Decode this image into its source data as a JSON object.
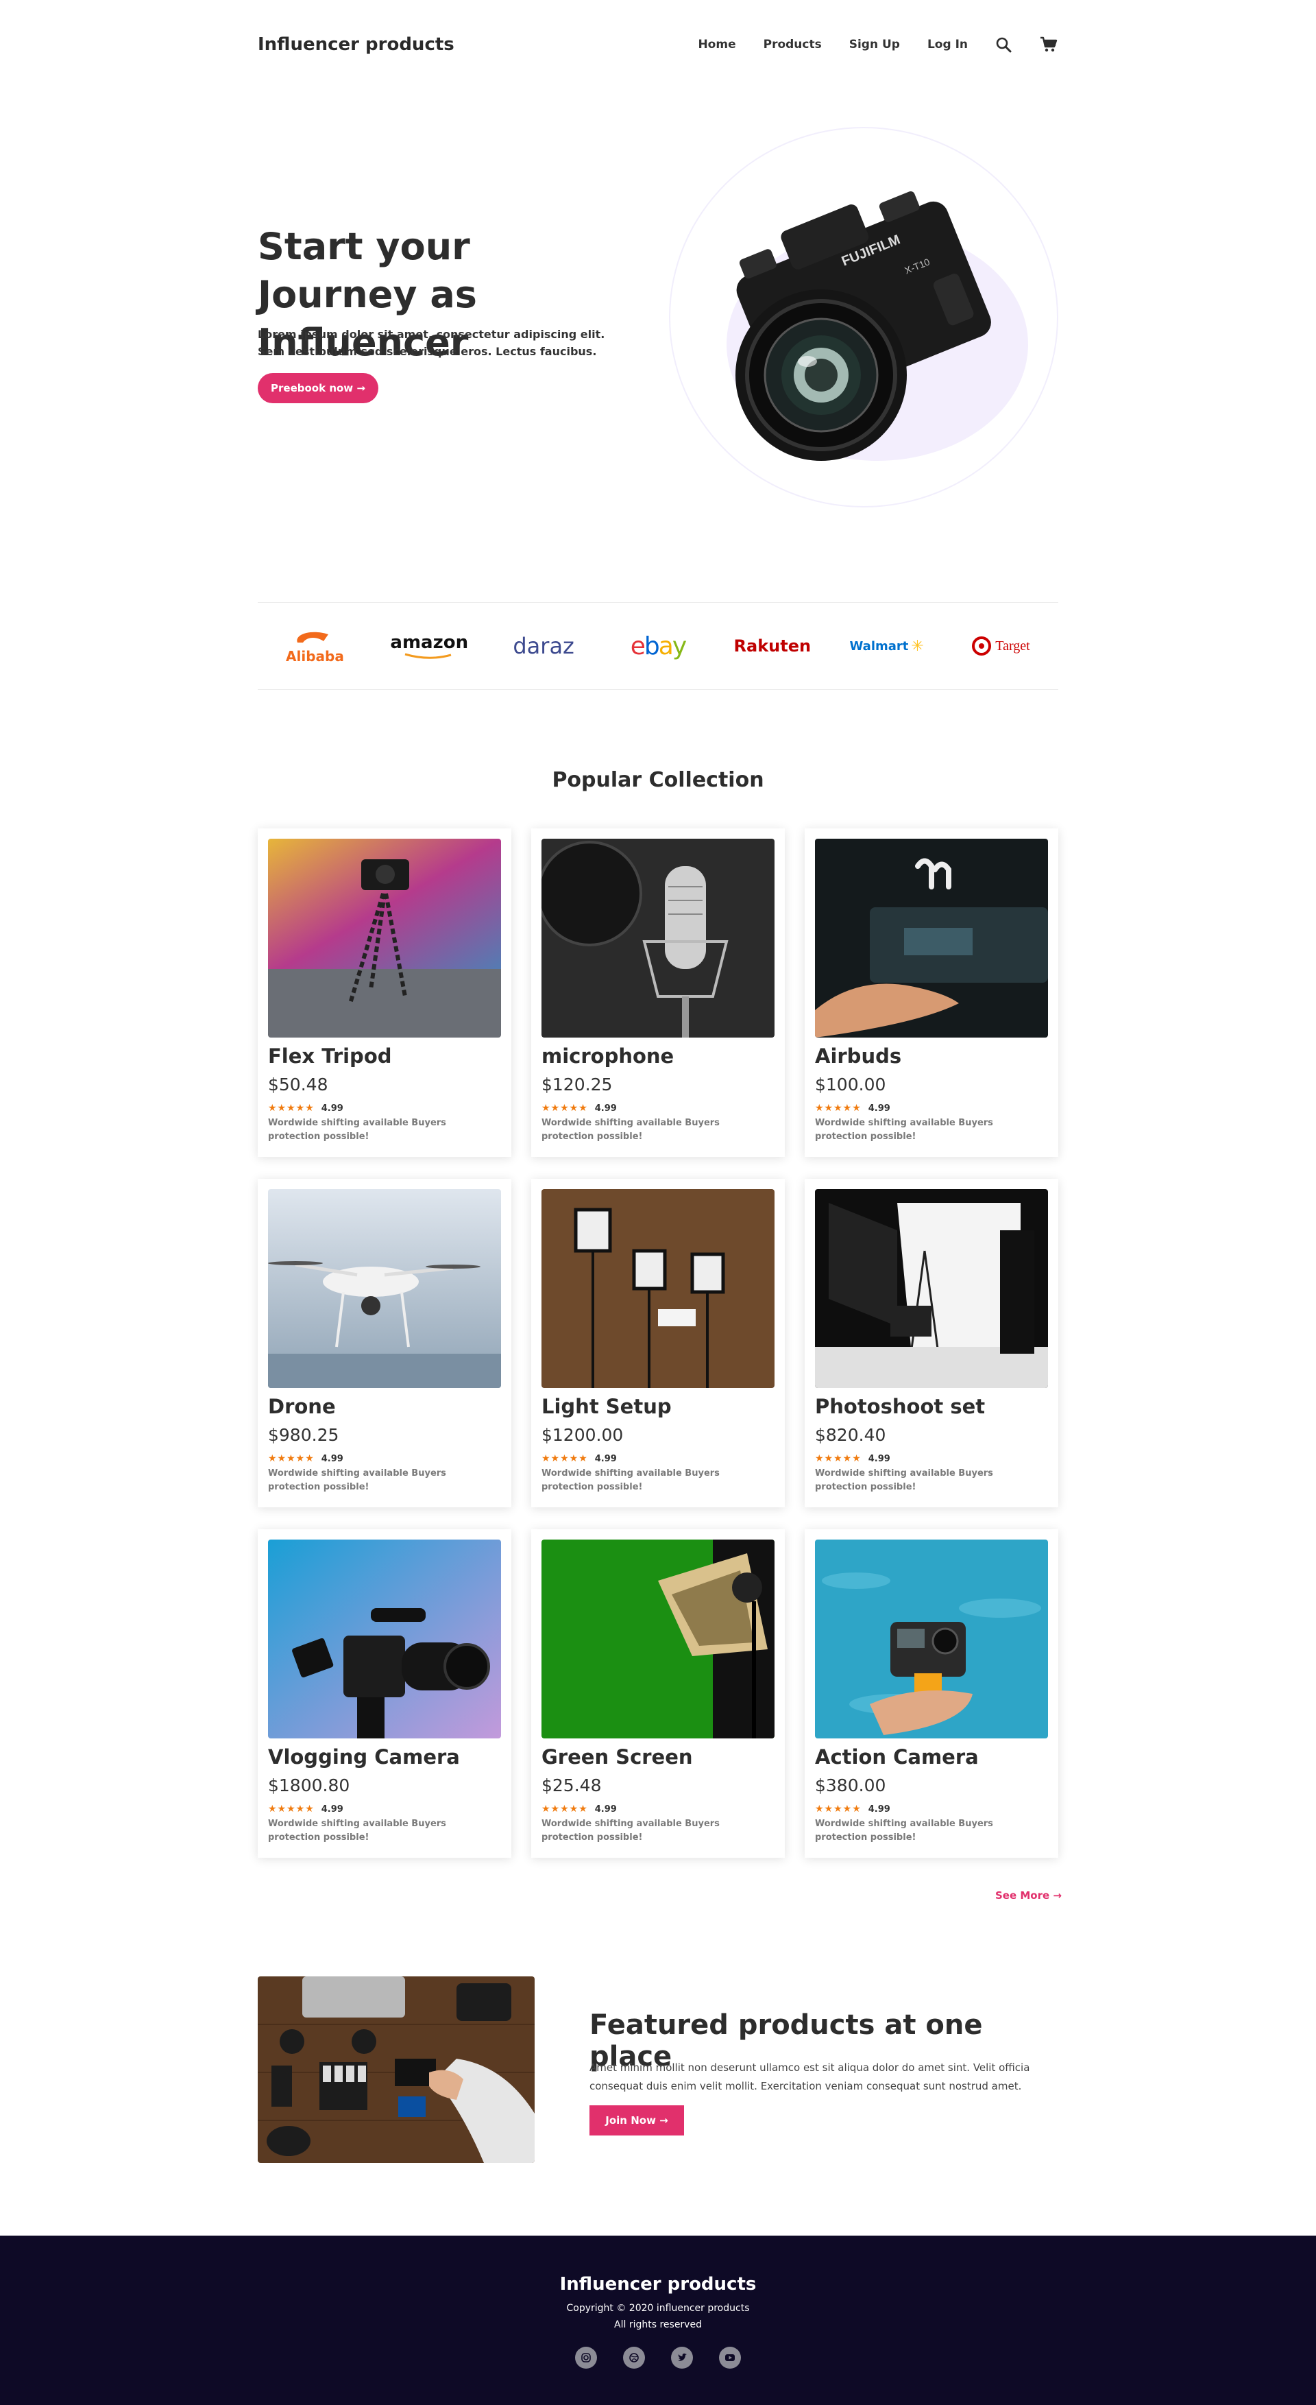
{
  "nav": {
    "brand": "Influencer products",
    "links": [
      "Home",
      "Products",
      "Sign Up",
      "Log In"
    ],
    "search_icon": "search-icon",
    "cart_icon": "cart-icon"
  },
  "hero": {
    "title": "Start your Journey as Influencer",
    "text": "Lorem ipsum dolor sit amet, consectetur adipiscing elit. Sem vestibulum sed scelerisque eros. Lectus faucibus.",
    "button": "Preebook now →",
    "camera_brand": "FUJIFILM",
    "camera_model": "X-T10"
  },
  "brands": [
    "Alibaba",
    "amazon",
    "daraz",
    "ebay",
    "Rakuten",
    "Walmart",
    "Target"
  ],
  "collection": {
    "title": "Popular Collection",
    "products": [
      {
        "name": "Flex Tripod",
        "price": "$50.48",
        "rating": "4.99",
        "note": "Wordwide shifting available Buyers protection possible!"
      },
      {
        "name": "microphone",
        "price": "$120.25",
        "rating": "4.99",
        "note": "Wordwide shifting available Buyers protection possible!"
      },
      {
        "name": "Airbuds",
        "price": "$100.00",
        "rating": "4.99",
        "note": "Wordwide shifting available Buyers protection possible!"
      },
      {
        "name": "Drone",
        "price": "$980.25",
        "rating": "4.99",
        "note": "Wordwide shifting available Buyers protection possible!"
      },
      {
        "name": "Light Setup",
        "price": "$1200.00",
        "rating": "4.99",
        "note": "Wordwide shifting available Buyers protection possible!"
      },
      {
        "name": "Photoshoot set",
        "price": "$820.40",
        "rating": "4.99",
        "note": "Wordwide shifting available Buyers protection possible!"
      },
      {
        "name": "Vlogging Camera",
        "price": "$1800.80",
        "rating": "4.99",
        "note": "Wordwide shifting available Buyers protection possible!"
      },
      {
        "name": "Green Screen",
        "price": "$25.48",
        "rating": "4.99",
        "note": "Wordwide shifting available Buyers protection possible!"
      },
      {
        "name": "Action Camera",
        "price": "$380.00",
        "rating": "4.99",
        "note": "Wordwide shifting available Buyers protection possible!"
      }
    ],
    "see_more": "See More →"
  },
  "featured": {
    "title": "Featured products at one place",
    "text": "Amet minim mollit non deserunt ullamco est sit aliqua dolor do amet sint. Velit officia consequat duis enim velit mollit. Exercitation veniam consequat sunt nostrud amet.",
    "button": "Join Now →"
  },
  "footer": {
    "brand": "Influencer products",
    "copyright": "Copyright © 2020 influencer products",
    "rights": "All rights reserved",
    "socials": [
      "instagram-icon",
      "dribbble-icon",
      "twitter-icon",
      "youtube-icon"
    ]
  },
  "colors": {
    "accent": "#e1306c",
    "footer_bg": "#0e0a26",
    "star": "#f07b0f"
  }
}
